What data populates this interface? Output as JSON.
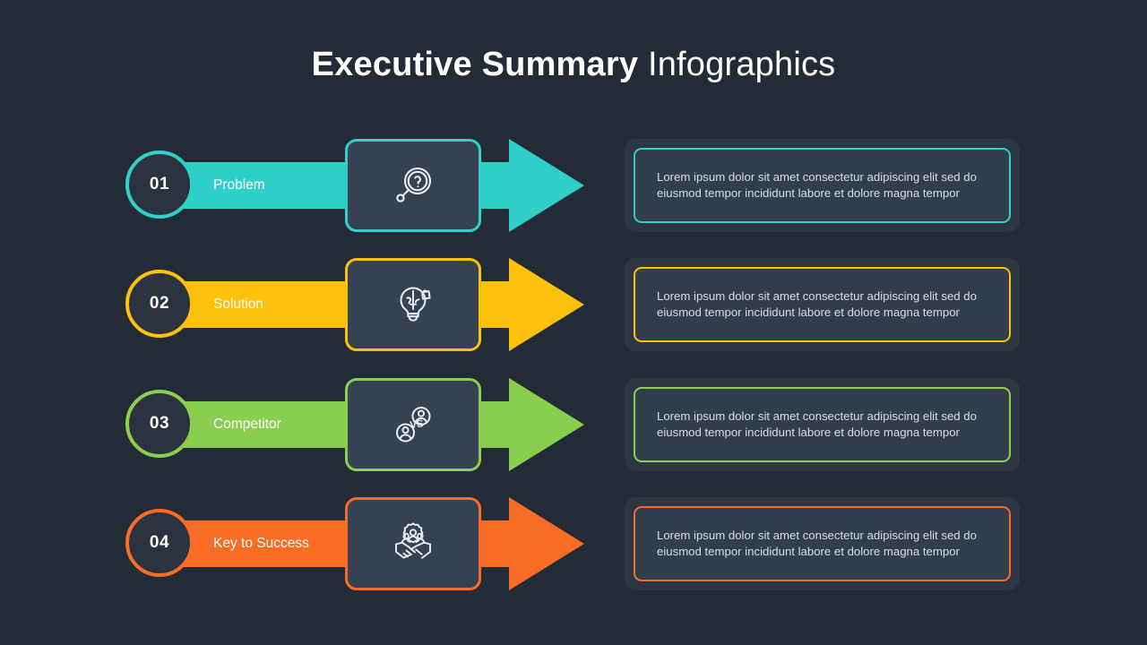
{
  "title": {
    "strong": "Executive Summary",
    "light": " Infographics"
  },
  "theme": {
    "background": "#232b36",
    "icon_tile_fill": "#364252",
    "card_outer_fill": "#2d3643",
    "card_inner_fill": "#333e4d",
    "circle_fill": "#2b3340",
    "text_color": "#d7dde5",
    "title_color": "#ffffff"
  },
  "rows": [
    {
      "number": "01",
      "label": "Problem",
      "color": "#2fd0c8",
      "icon": "magnifier-question-icon",
      "description": "Lorem ipsum dolor sit amet consectetur adipiscing elit sed do eiusmod tempor incididunt  labore et dolore magna tempor"
    },
    {
      "number": "02",
      "label": "Solution",
      "color": "#fcc10b",
      "icon": "lightbulb-puzzle-icon",
      "description": "Lorem ipsum dolor sit amet consectetur adipiscing elit sed do eiusmod tempor incididunt  labore et dolore magna tempor"
    },
    {
      "number": "03",
      "label": "Competitor",
      "color": "#8ace4f",
      "icon": "versus-people-icon",
      "description": "Lorem ipsum dolor sit amet consectetur adipiscing elit sed do eiusmod tempor incididunt  labore et dolore magna tempor"
    },
    {
      "number": "04",
      "label": "Key to Success",
      "color": "#f96c25",
      "icon": "handshake-team-icon",
      "description": "Lorem ipsum dolor sit amet consectetur adipiscing elit sed do eiusmod tempor incididunt  labore et dolore magna tempor"
    }
  ]
}
